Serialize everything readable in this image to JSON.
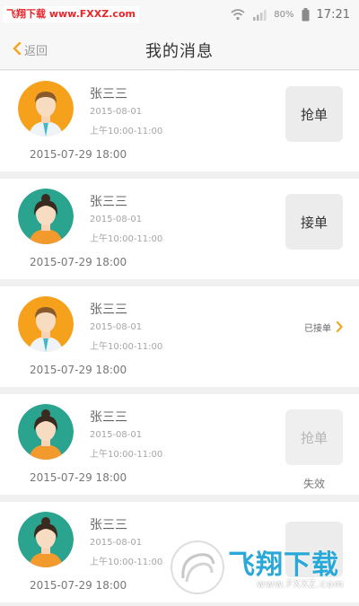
{
  "status_bar": {
    "watermark": "飞翔下载 www.FXXZ.com",
    "battery": "80%",
    "time": "17:21"
  },
  "nav": {
    "back_label": "返回",
    "title": "我的消息"
  },
  "messages": [
    {
      "name": "张三三",
      "date": "2015-08-01",
      "timeslot": "上午10:00-11:00",
      "posted": "2015-07-29 18:00",
      "avatar": "male-avatar-icon",
      "action": "抢单",
      "state": "active"
    },
    {
      "name": "张三三",
      "date": "2015-08-01",
      "timeslot": "上午10:00-11:00",
      "posted": "2015-07-29 18:00",
      "avatar": "female-avatar-icon",
      "action": "接单",
      "state": "active"
    },
    {
      "name": "张三三",
      "date": "2015-08-01",
      "timeslot": "上午10:00-11:00",
      "posted": "2015-07-29 18:00",
      "avatar": "male-avatar-icon",
      "status_label": "已接单",
      "state": "accepted"
    },
    {
      "name": "张三三",
      "date": "2015-08-01",
      "timeslot": "上午10:00-11:00",
      "posted": "2015-07-29 18:00",
      "avatar": "female-avatar-icon",
      "action": "抢单",
      "expired_label": "失效",
      "state": "expired"
    },
    {
      "name": "张三三",
      "date": "2015-08-01",
      "timeslot": "上午10:00-11:00",
      "posted": "2015-07-29 18:00",
      "avatar": "female-avatar-icon",
      "state": "partial"
    }
  ],
  "logo_watermark": {
    "main": "飞翔下载",
    "url": "www.FXXZ.com"
  },
  "colors": {
    "accent": "#f5a623",
    "male_avatar_bg": "#f5a11c",
    "female_avatar_bg": "#2aa38f",
    "watermark_red": "#e8262a",
    "logo_blue": "#2aa9d8"
  }
}
